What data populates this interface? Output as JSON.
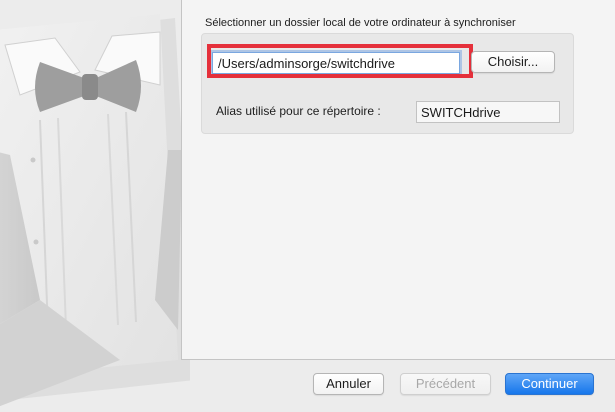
{
  "dialog": {
    "section_title": "Sélectionner un dossier local de votre ordinateur à synchroniser",
    "local_folder": {
      "value": "/Users/adminsorge/switchdrive",
      "choose_label": "Choisir..."
    },
    "alias": {
      "label": "Alias utilisé pour ce répertoire :",
      "value": "SWITCHdrive"
    }
  },
  "footer": {
    "cancel_label": "Annuler",
    "previous_label": "Précédent",
    "continue_label": "Continuer"
  },
  "colors": {
    "highlight": "#e5303b",
    "primary_button": "#1676eb"
  },
  "illustration": {
    "icon": "tuxedo-bowtie-illustration"
  }
}
